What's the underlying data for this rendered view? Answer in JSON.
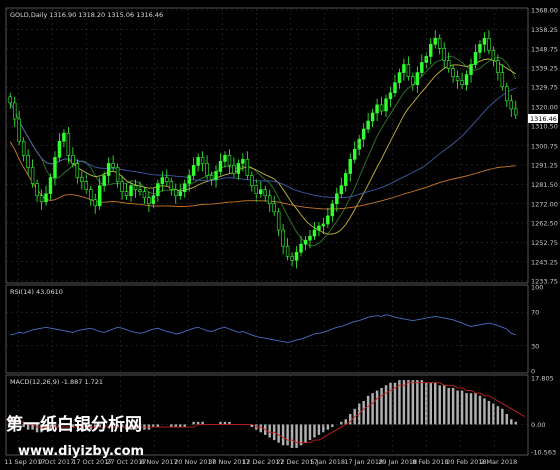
{
  "colors": {
    "background": "#000000",
    "grid": "#3c3c3c",
    "frame": "#8c8c8c",
    "bull_candle": "#32ff32",
    "bear_candle": "#000000",
    "ma_green": "#2f7a2f",
    "ma_yellow": "#c2b73a",
    "ma_blue": "#3f5aa8",
    "ma_orange": "#c9792a",
    "rsi_line": "#4a6cc4",
    "macd_hist": "#b0b0b0",
    "macd_signal": "#c82020",
    "price_tag": "#ffffff",
    "watermark": "#ffffff"
  },
  "chart_data": [
    {
      "type": "candlestick",
      "title": "GOLD,Daily  1316.90 1318.20 1315.06 1316.46",
      "current_price_label": "1316.46",
      "ylim": [
        1233.75,
        1368.0
      ],
      "y_ticks": [
        "1368.00",
        "1358.25",
        "1348.75",
        "1339.25",
        "1329.75",
        "1320.00",
        "1310.50",
        "1300.75",
        "1291.25",
        "1281.50",
        "1272.00",
        "1262.50",
        "1252.75",
        "1243.25",
        "1233.75"
      ],
      "x_ticks": [
        "11 Sep 2017",
        "9 Oct 2017",
        "17 Oct 2017",
        "27 Oct 2017",
        "8 Nov 2017",
        "20 Nov 2017",
        "30 Nov 2017",
        "12 Dec 2017",
        "22 Dec 2017",
        "5 Jan 2018",
        "17 Jan 2018",
        "29 Jan 2018",
        "8 Feb 2018",
        "20 Feb 2018",
        "2 Mar 2018"
      ],
      "moving_averages_note": "four moving averages (green, yellow, blue, orange) drawn without printed labels",
      "close_series": [
        1322,
        1314,
        1303,
        1296,
        1290,
        1282,
        1276,
        1273,
        1277,
        1285,
        1295,
        1303,
        1307,
        1296,
        1292,
        1285,
        1283,
        1279,
        1274,
        1271,
        1281,
        1286,
        1292,
        1290,
        1283,
        1278,
        1276,
        1281,
        1279,
        1278,
        1275,
        1272,
        1276,
        1282,
        1285,
        1283,
        1279,
        1276,
        1278,
        1282,
        1286,
        1291,
        1295,
        1292,
        1286,
        1284,
        1288,
        1293,
        1296,
        1291,
        1287,
        1292,
        1294,
        1286,
        1281,
        1277,
        1279,
        1276,
        1272,
        1268,
        1259,
        1251,
        1246,
        1244,
        1248,
        1252,
        1254,
        1256,
        1259,
        1261,
        1262,
        1266,
        1272,
        1277,
        1281,
        1287,
        1294,
        1299,
        1304,
        1309,
        1313,
        1317,
        1321,
        1318,
        1324,
        1327,
        1332,
        1337,
        1341,
        1335,
        1331,
        1337,
        1342,
        1345,
        1351,
        1354,
        1349,
        1343,
        1339,
        1335,
        1333,
        1331,
        1336,
        1341,
        1347,
        1351,
        1354,
        1348,
        1343,
        1337,
        1330,
        1323,
        1319,
        1316
      ]
    },
    {
      "type": "line",
      "title": "RSI(14) 43.0610",
      "ylim": [
        0,
        100
      ],
      "y_ticks": [
        "100",
        "70",
        "30",
        "0"
      ],
      "levels": [
        70,
        30
      ],
      "values": [
        43,
        44,
        46,
        45,
        47,
        49,
        50,
        51,
        52,
        51,
        50,
        49,
        48,
        47,
        46,
        48,
        49,
        50,
        51,
        49,
        47,
        46,
        48,
        50,
        52,
        51,
        49,
        47,
        46,
        45,
        46,
        48,
        50,
        51,
        49,
        47,
        46,
        44,
        45,
        47,
        49,
        51,
        52,
        50,
        48,
        47,
        49,
        51,
        52,
        50,
        48,
        46,
        47,
        45,
        43,
        41,
        40,
        39,
        38,
        37,
        36,
        35,
        34,
        35,
        37,
        38,
        40,
        42,
        44,
        45,
        46,
        48,
        50,
        52,
        53,
        55,
        57,
        59,
        60,
        62,
        64,
        65,
        66,
        65,
        67,
        66,
        64,
        63,
        62,
        61,
        60,
        61,
        62,
        63,
        64,
        65,
        64,
        63,
        62,
        61,
        59,
        57,
        55,
        53,
        54,
        55,
        56,
        57,
        56,
        54,
        52,
        50,
        45,
        43
      ]
    },
    {
      "type": "bar",
      "title": "MACD(12,26,9) -1.887 1.721",
      "ylim": [
        -10.563,
        17.805
      ],
      "y_ticks": [
        "17.805",
        "0.00",
        "-10.563"
      ],
      "histogram": [
        2,
        1,
        0,
        -1,
        -2,
        -2,
        -3,
        -3,
        -2,
        -2,
        -1,
        -1,
        0,
        0,
        -1,
        -1,
        -2,
        -2,
        -2,
        -2,
        -1,
        -1,
        0,
        0,
        -1,
        -1,
        -2,
        -2,
        -2,
        -2,
        -2,
        -2,
        -1,
        -1,
        0,
        0,
        -1,
        -1,
        -1,
        -1,
        0,
        1,
        1,
        1,
        0,
        0,
        0,
        1,
        1,
        1,
        0,
        0,
        0,
        0,
        -1,
        -2,
        -3,
        -4,
        -5,
        -6,
        -7,
        -8,
        -8,
        -9,
        -9,
        -8,
        -7,
        -6,
        -5,
        -4,
        -3,
        -2,
        -1,
        0,
        1,
        2,
        4,
        6,
        8,
        9,
        11,
        12,
        13,
        14,
        15,
        16,
        16,
        17,
        17,
        17,
        17,
        17,
        17,
        16,
        16,
        16,
        15,
        15,
        14,
        14,
        13,
        13,
        12,
        12,
        12,
        11,
        10,
        9,
        8,
        7,
        6,
        4,
        2,
        1
      ],
      "signal": [
        2,
        2,
        1,
        1,
        0,
        0,
        -1,
        -1,
        -1,
        -1,
        -1,
        -1,
        -1,
        -1,
        -1,
        -1,
        -1,
        -1,
        -1,
        -1,
        -1,
        -1,
        -1,
        -1,
        -1,
        -1,
        -1,
        -1,
        -1,
        -1,
        -1,
        -1,
        -1,
        -1,
        -1,
        -1,
        -1,
        -1,
        -1,
        -1,
        -1,
        -1,
        0,
        0,
        0,
        0,
        0,
        0,
        0,
        0,
        0,
        0,
        0,
        0,
        0,
        -1,
        -1,
        -2,
        -3,
        -3,
        -4,
        -5,
        -6,
        -6,
        -7,
        -7,
        -7,
        -7,
        -6,
        -6,
        -5,
        -4,
        -3,
        -2,
        -1,
        0,
        1,
        3,
        4,
        6,
        7,
        8,
        10,
        11,
        12,
        13,
        14,
        15,
        15,
        16,
        16,
        16,
        16,
        16,
        16,
        16,
        16,
        15,
        15,
        15,
        14,
        14,
        13,
        13,
        12,
        12,
        11,
        11,
        10,
        9,
        8,
        7,
        6,
        5,
        4,
        3
      ]
    }
  ],
  "watermark": {
    "line1": "第一纸白银分析网",
    "line2": "www.diyizby.com"
  }
}
